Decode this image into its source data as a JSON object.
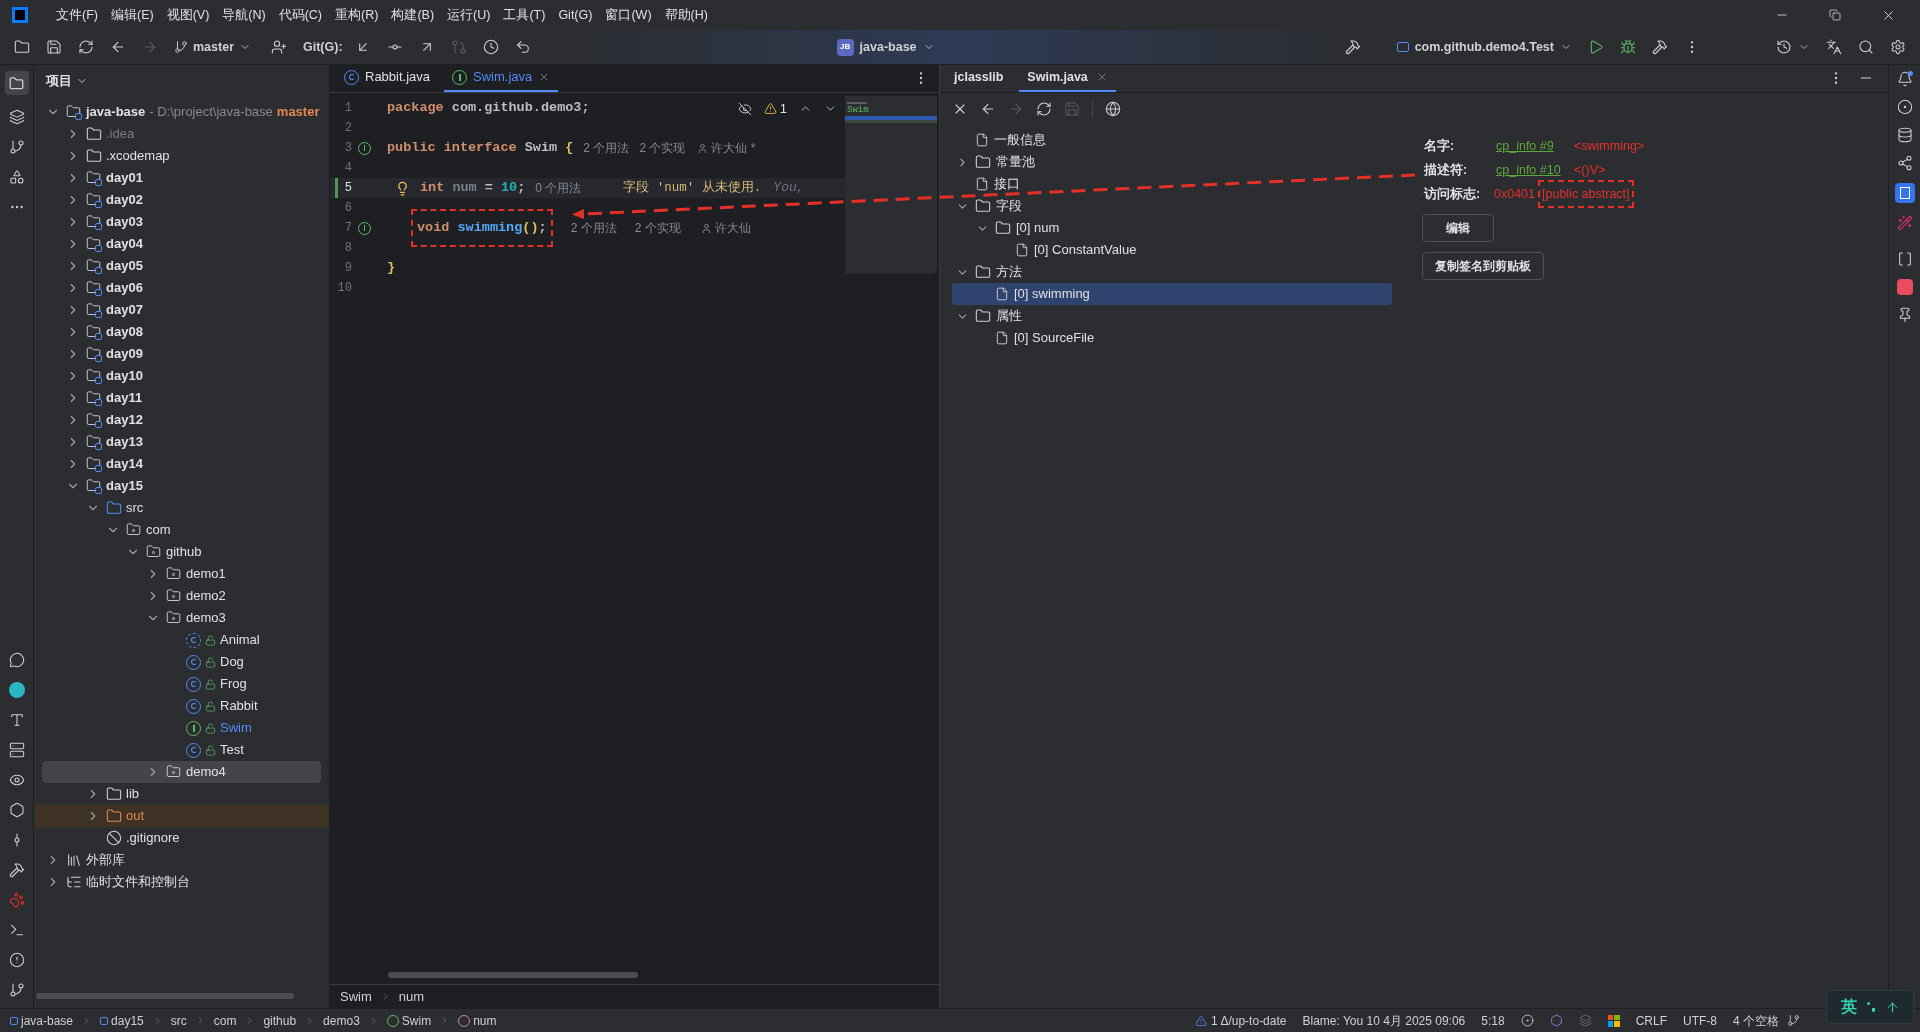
{
  "menu": [
    "文件(F)",
    "编辑(E)",
    "视图(V)",
    "导航(N)",
    "代码(C)",
    "重构(R)",
    "构建(B)",
    "运行(U)",
    "工具(T)",
    "Git(G)",
    "窗口(W)",
    "帮助(H)"
  ],
  "toolbar": {
    "branch": "master",
    "git_label": "Git(G):",
    "project": {
      "badge": "JB",
      "name": "java-base"
    },
    "run_config": "com.github.demo4.Test"
  },
  "project_panel": {
    "title": "项目",
    "tree": [
      {
        "label": "java-base",
        "kind": "module",
        "detail": " - D:\\project\\java-base",
        "branch": "master",
        "expanded": true,
        "selected": false,
        "children": [
          {
            "label": ".idea",
            "kind": "hidden-folder",
            "expanded": false,
            "selected": false
          },
          {
            "label": ".xcodemap",
            "kind": "folder",
            "expanded": false,
            "selected": false
          },
          {
            "label": "day01",
            "kind": "module",
            "expanded": false,
            "selected": false
          },
          {
            "label": "day02",
            "kind": "module",
            "expanded": false,
            "selected": false
          },
          {
            "label": "day03",
            "kind": "module",
            "expanded": false,
            "selected": false
          },
          {
            "label": "day04",
            "kind": "module",
            "expanded": false,
            "selected": false
          },
          {
            "label": "day05",
            "kind": "module",
            "expanded": false,
            "selected": false
          },
          {
            "label": "day06",
            "kind": "module",
            "expanded": false,
            "selected": false
          },
          {
            "label": "day07",
            "kind": "module",
            "expanded": false,
            "selected": false
          },
          {
            "label": "day08",
            "kind": "module",
            "expanded": false,
            "selected": false
          },
          {
            "label": "day09",
            "kind": "module",
            "expanded": false,
            "selected": false
          },
          {
            "label": "day10",
            "kind": "module",
            "expanded": false,
            "selected": false
          },
          {
            "label": "day11",
            "kind": "module",
            "expanded": false,
            "selected": false
          },
          {
            "label": "day12",
            "kind": "module",
            "expanded": false,
            "selected": false
          },
          {
            "label": "day13",
            "kind": "module",
            "expanded": false,
            "selected": false
          },
          {
            "label": "day14",
            "kind": "module",
            "expanded": false,
            "selected": false
          },
          {
            "label": "day15",
            "kind": "module",
            "expanded": true,
            "selected": false,
            "children": [
              {
                "label": "src",
                "kind": "source",
                "expanded": true,
                "selected": false,
                "children": [
                  {
                    "label": "com",
                    "kind": "package",
                    "expanded": true,
                    "selected": false,
                    "children": [
                      {
                        "label": "github",
                        "kind": "package",
                        "expanded": true,
                        "selected": false,
                        "children": [
                          {
                            "label": "demo1",
                            "kind": "package",
                            "expanded": false,
                            "selected": false
                          },
                          {
                            "label": "demo2",
                            "kind": "package",
                            "expanded": false,
                            "selected": false
                          },
                          {
                            "label": "demo3",
                            "kind": "package",
                            "expanded": true,
                            "selected": false,
                            "children": [
                              {
                                "label": "Animal",
                                "kind": "abstract-class",
                                "selected": false
                              },
                              {
                                "label": "Dog",
                                "kind": "class",
                                "selected": false
                              },
                              {
                                "label": "Frog",
                                "kind": "class",
                                "selected": false
                              },
                              {
                                "label": "Rabbit",
                                "kind": "class",
                                "selected": false
                              },
                              {
                                "label": "Swim",
                                "kind": "interface",
                                "selected": false
                              },
                              {
                                "label": "Test",
                                "kind": "main-class",
                                "selected": false
                              }
                            ]
                          },
                          {
                            "label": "demo4",
                            "kind": "package",
                            "expanded": false,
                            "selected": true
                          }
                        ]
                      }
                    ]
                  }
                ]
              },
              {
                "label": "lib",
                "kind": "folder",
                "expanded": false,
                "selected": false
              },
              {
                "label": "out",
                "kind": "excluded",
                "expanded": false,
                "selected": false
              },
              {
                "label": ".gitignore",
                "kind": "ignore-file",
                "selected": false
              }
            ]
          }
        ]
      },
      {
        "label": "外部库",
        "kind": "library",
        "expanded": false,
        "selected": false
      },
      {
        "label": "临时文件和控制台",
        "kind": "scratch",
        "expanded": false,
        "selected": false
      }
    ]
  },
  "editor": {
    "tabs": [
      {
        "label": "Rabbit.java",
        "kind": "class",
        "selected": false
      },
      {
        "label": "Swim.java",
        "kind": "interface",
        "selected": true
      }
    ],
    "warnings": "1",
    "minimap_label": "Swim",
    "lines": [
      {
        "number": "1",
        "current": false,
        "implemented": false,
        "bulb": false,
        "boxed": false,
        "tokens": [
          {
            "kind": "keyword",
            "text": "package "
          },
          {
            "kind": "plain",
            "text": "com.github.demo3;"
          }
        ]
      },
      {
        "number": "2",
        "current": false,
        "implemented": false,
        "bulb": false
      },
      {
        "number": "3",
        "current": false,
        "implemented": true,
        "bulb": false,
        "boxed": false,
        "tokens": [
          {
            "kind": "keyword",
            "text": "public interface "
          },
          {
            "kind": "plain",
            "text": "Swim "
          },
          {
            "kind": "brace",
            "text": "{"
          },
          {
            "kind": "hint",
            "text": "2 个用法"
          },
          {
            "kind": "hint",
            "text": "2 个实现"
          },
          {
            "kind": "author",
            "text": "许大仙 *"
          }
        ]
      },
      {
        "number": "4",
        "current": false,
        "implemented": false,
        "bulb": false
      },
      {
        "number": "5",
        "current": true,
        "implemented": false,
        "bulb": true,
        "boxed": false,
        "tokens": [
          {
            "kind": "keyword",
            "text": "int "
          },
          {
            "kind": "unused",
            "text": "num "
          },
          {
            "kind": "plain",
            "text": "= "
          },
          {
            "kind": "number",
            "text": "10"
          },
          {
            "kind": "plain",
            "text": ";"
          },
          {
            "kind": "hint",
            "text": "0 个用法"
          },
          {
            "kind": "warning",
            "text": "字段 'num' 从未使用."
          },
          {
            "kind": "blame",
            "text": "You,"
          }
        ]
      },
      {
        "number": "6",
        "current": false,
        "implemented": false,
        "bulb": false
      },
      {
        "number": "7",
        "current": false,
        "implemented": true,
        "bulb": false,
        "boxed": true,
        "tokens": [
          {
            "kind": "keyword",
            "text": "void "
          },
          {
            "kind": "method",
            "text": "swimming"
          },
          {
            "kind": "brace",
            "text": "()"
          },
          {
            "kind": "plain",
            "text": ";"
          },
          {
            "kind": "hint",
            "text": "2 个用法"
          },
          {
            "kind": "hint",
            "text": "2 个实现"
          },
          {
            "kind": "author",
            "text": "许大仙"
          }
        ]
      },
      {
        "number": "8",
        "current": false,
        "implemented": false,
        "bulb": false
      },
      {
        "number": "9",
        "current": false,
        "implemented": false,
        "bulb": false,
        "boxed": false,
        "tokens": [
          {
            "kind": "brace",
            "text": "}"
          }
        ]
      },
      {
        "number": "10",
        "current": false,
        "implemented": false,
        "bulb": false
      }
    ],
    "breadcrumbs": [
      "Swim",
      "num"
    ]
  },
  "jclasslib": {
    "tabs": [
      {
        "label": "jclasslib",
        "selected": false
      },
      {
        "label": "Swim.java",
        "selected": true
      }
    ],
    "tree": [
      {
        "label": "一般信息",
        "kind": "file",
        "selected": false
      },
      {
        "label": "常量池",
        "kind": "folder",
        "expanded": false,
        "selected": false
      },
      {
        "label": "接口",
        "kind": "file",
        "selected": false
      },
      {
        "label": "字段",
        "kind": "folder",
        "expanded": true,
        "selected": false,
        "children": [
          {
            "label": "[0] num",
            "kind": "folder",
            "expanded": true,
            "selected": false,
            "children": [
              {
                "label": "[0] ConstantValue",
                "kind": "file",
                "selected": false
              }
            ]
          }
        ]
      },
      {
        "label": "方法",
        "kind": "folder",
        "expanded": true,
        "selected": false,
        "children": [
          {
            "label": "[0] swimming",
            "kind": "file",
            "selected": true
          }
        ]
      },
      {
        "label": "属性",
        "kind": "folder",
        "expanded": true,
        "selected": false,
        "children": [
          {
            "label": "[0] SourceFile",
            "kind": "file",
            "selected": false
          }
        ]
      }
    ],
    "details": [
      {
        "label": "名字:",
        "link": "cp_info #9",
        "value": "<swimming>",
        "boxed": false
      },
      {
        "label": "描述符:",
        "link": "cp_info #10",
        "value": "<()V>",
        "boxed": false
      },
      {
        "label": "访问标志:",
        "code": "0x0401",
        "value": "[public abstract]",
        "boxed": true
      }
    ],
    "buttons": [
      "编辑",
      "复制签名到剪贴板"
    ]
  },
  "status_bar": {
    "breadcrumbs": [
      {
        "label": "java-base",
        "kind": "module"
      },
      {
        "label": "day15",
        "kind": "module"
      },
      {
        "label": "src",
        "kind": "plain"
      },
      {
        "label": "com",
        "kind": "plain"
      },
      {
        "label": "github",
        "kind": "plain"
      },
      {
        "label": "demo3",
        "kind": "plain"
      },
      {
        "label": "Swim",
        "kind": "interface"
      },
      {
        "label": "num",
        "kind": "field"
      }
    ],
    "vcs": "1 Δ/up-to-date",
    "blame": "Blame: You 10 4月 2025 09:06",
    "position": "5:18",
    "line_separator": "CRLF",
    "encoding": "UTF-8",
    "indent": "4 个空格"
  },
  "ime": {
    "mode": "英"
  }
}
